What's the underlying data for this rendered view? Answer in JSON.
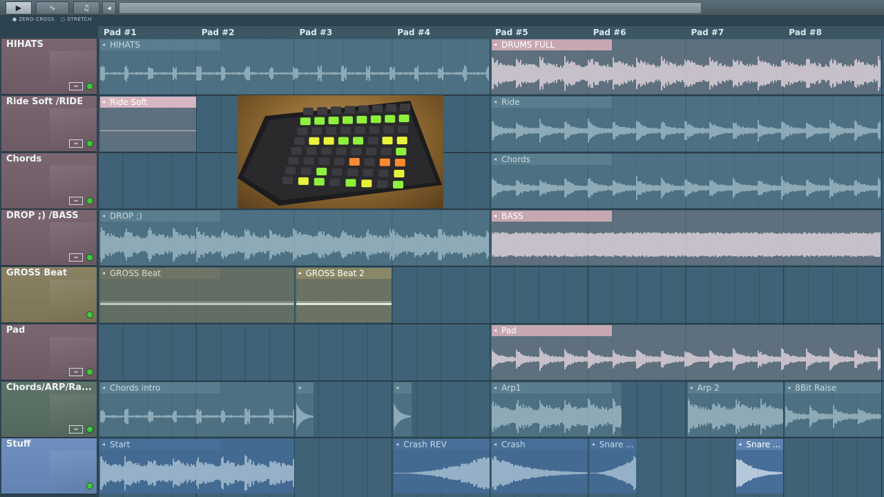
{
  "toolbar": {
    "buttons": [
      {
        "name": "playlist-mode-button",
        "glyph": "▶"
      },
      {
        "name": "automation-button",
        "glyph": "∿"
      },
      {
        "name": "note-button",
        "glyph": "♫"
      }
    ],
    "scroll_left_glyph": "◂",
    "zero_cross_label": "ZERO-CROSS",
    "stretch_label": "STRETCH"
  },
  "ruler": {
    "pads": [
      "Pad #1",
      "Pad #2",
      "Pad #3",
      "Pad #4",
      "Pad #5",
      "Pad #6",
      "Pad #7",
      "Pad #8"
    ]
  },
  "tracks": [
    {
      "id": "hihats",
      "name": "HIHATS",
      "color": "#7a6670",
      "has_mix": true
    },
    {
      "id": "ride",
      "name": "Ride Soft /RIDE",
      "color": "#7a6670",
      "has_mix": true
    },
    {
      "id": "chords",
      "name": "Chords",
      "color": "#7a6670",
      "has_mix": true
    },
    {
      "id": "drop",
      "name": "DROP ;) /BASS",
      "color": "#7a6670",
      "has_mix": true
    },
    {
      "id": "gross",
      "name": "GROSS Beat",
      "color": "#8a8062",
      "has_mix": false
    },
    {
      "id": "pad",
      "name": "Pad",
      "color": "#7a6670",
      "has_mix": true
    },
    {
      "id": "arp",
      "name": "Chords/ARP/Ra...",
      "color": "#5f7468",
      "has_mix": true
    },
    {
      "id": "stuff",
      "name": "Stuff",
      "color": "#6f8fbf",
      "has_mix": false
    }
  ],
  "clips": [
    {
      "track": 0,
      "label": "HIHATS",
      "start": 0,
      "end": 4,
      "style": "dim",
      "wave": "sparse"
    },
    {
      "track": 0,
      "label": "DRUMS FULL",
      "start": 4,
      "end": 8,
      "style": "pink",
      "wave": "dense"
    },
    {
      "track": 1,
      "label": "Ride Soft",
      "start": 0,
      "end": 1,
      "style": "pink-selected",
      "wave": "line"
    },
    {
      "track": 1,
      "label": "Ride",
      "start": 4,
      "end": 8,
      "style": "dim",
      "wave": "medium"
    },
    {
      "track": 2,
      "label": "Chords",
      "start": 4,
      "end": 8,
      "style": "dim",
      "wave": "medium"
    },
    {
      "track": 3,
      "label": "DROP ;)",
      "start": 0,
      "end": 4,
      "style": "dim",
      "wave": "dense"
    },
    {
      "track": 3,
      "label": "BASS",
      "start": 4,
      "end": 8,
      "style": "pink",
      "wave": "full"
    },
    {
      "track": 4,
      "label": "GROSS Beat",
      "start": 0,
      "end": 2,
      "style": "tan",
      "wave": "auto"
    },
    {
      "track": 4,
      "label": "GROSS Beat 2",
      "start": 2,
      "end": 3,
      "style": "tan-selected",
      "wave": "auto"
    },
    {
      "track": 5,
      "label": "Pad",
      "start": 4,
      "end": 8,
      "style": "pink",
      "wave": "medium"
    },
    {
      "track": 6,
      "label": "Chords intro",
      "start": 0,
      "end": 2,
      "style": "dim",
      "wave": "sparse"
    },
    {
      "track": 6,
      "label": "",
      "start": 2,
      "end": 2.2,
      "style": "dim",
      "wave": "spike"
    },
    {
      "track": 6,
      "label": "",
      "start": 3,
      "end": 3.2,
      "style": "dim",
      "wave": "spike"
    },
    {
      "track": 6,
      "label": "Arp1",
      "start": 4,
      "end": 5.35,
      "style": "dim",
      "wave": "dense"
    },
    {
      "track": 6,
      "label": "Arp 2",
      "start": 6,
      "end": 7,
      "style": "dim",
      "wave": "dense"
    },
    {
      "track": 6,
      "label": "8Bit Raise",
      "start": 7,
      "end": 8,
      "style": "dim",
      "wave": "medium"
    },
    {
      "track": 7,
      "label": "Start",
      "start": 0,
      "end": 2,
      "style": "blue",
      "wave": "dense"
    },
    {
      "track": 7,
      "label": "Crash REV",
      "start": 3,
      "end": 4,
      "style": "blue",
      "wave": "swell"
    },
    {
      "track": 7,
      "label": "Crash",
      "start": 4,
      "end": 5,
      "style": "blue",
      "wave": "fade"
    },
    {
      "track": 7,
      "label": "Snare ...",
      "start": 5,
      "end": 5.5,
      "style": "blue",
      "wave": "swell"
    },
    {
      "track": 7,
      "label": "Snare ...",
      "start": 6.5,
      "end": 7,
      "style": "blue-selected",
      "wave": "fade"
    }
  ],
  "launchpad": {
    "pads": [
      "000000000",
      "gggggggg0",
      "00000000yy",
      "0yygg0yyo",
      "0000000gy",
      "0000o0oog",
      "00g0000y0",
      "0yg0gy0gy"
    ]
  }
}
